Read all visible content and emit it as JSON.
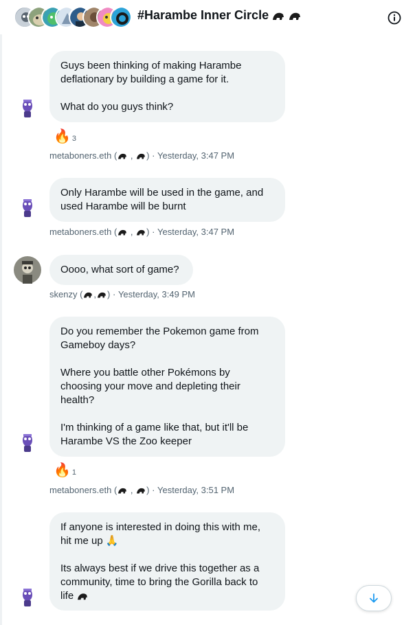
{
  "header": {
    "title": "#Harambe Inner Circle",
    "avatar_count": 8
  },
  "messages": [
    {
      "author": "metaboners.eth",
      "time": "Yesterday, 3:47 PM",
      "lines": [
        "Guys been thinking of making Harambe",
        "deflationary by building a game for it.",
        "",
        "What do you guys think?"
      ],
      "reaction": {
        "emoji": "🔥",
        "count": "3"
      }
    },
    {
      "author": "metaboners.eth",
      "time": "Yesterday, 3:47 PM",
      "lines": [
        "Only Harambe will be used in the game, and",
        "used Harambe will be burnt"
      ]
    },
    {
      "author": "skenzy",
      "time": "Yesterday, 3:49 PM",
      "lines": [
        "Oooo, what sort of game?"
      ]
    },
    {
      "author": "metaboners.eth",
      "time": "Yesterday, 3:51 PM",
      "lines": [
        "Do you remember the Pokemon game from",
        "Gameboy days?",
        "",
        "Where you battle other Pokémons by",
        "choosing your move and depleting their",
        "health?",
        "",
        "I'm thinking of a game like that, but it'll be",
        "Harambe VS the Zoo keeper"
      ],
      "reaction": {
        "emoji": "🔥",
        "count": "1"
      }
    },
    {
      "author": "metaboners.eth",
      "lines": [
        "If anyone is interested in doing this with me,",
        "hit me up 🙏",
        "",
        "Its always best if we drive this together as a",
        "community, time to bring the Gorilla back to",
        "life"
      ]
    }
  ],
  "colors": {
    "bubble": "#eff3f4",
    "meta": "#536471",
    "accent": "#1d9bf0"
  },
  "icons": {
    "info": "info-icon",
    "scroll": "arrow-down-icon",
    "gorilla": "gorilla-emoji",
    "fire": "fire-emoji"
  }
}
